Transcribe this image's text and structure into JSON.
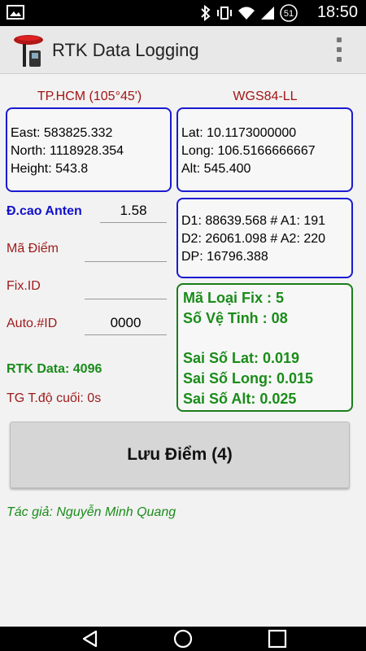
{
  "status_bar": {
    "time": "18:50",
    "battery_level": "51",
    "icons": [
      "image-icon",
      "bluetooth-icon",
      "vibrate-icon",
      "wifi-icon",
      "signal-icon",
      "battery-icon"
    ]
  },
  "action_bar": {
    "title": "RTK Data Logging",
    "overflow_icon": "more-vert-icon"
  },
  "headers": {
    "local": "TP.HCM (105°45')",
    "global": "WGS84-LL"
  },
  "local_coords": {
    "east": "East: 583825.332",
    "north": "North: 1118928.354",
    "height": "Height: 543.8"
  },
  "wgs_coords": {
    "lat": "Lat: 10.1173000000",
    "long": "Long: 106.5166666667",
    "alt": "Alt: 545.400"
  },
  "distances": {
    "d1": "D1: 88639.568 # A1: 191",
    "d2": "D2: 26061.098 # A2: 220",
    "dp": "DP: 16796.388"
  },
  "form": {
    "antenna_label": "Đ.cao Anten",
    "antenna_value": "1.58",
    "point_label": "Mã Điểm",
    "point_value": "",
    "fixid_label": "Fix.ID",
    "fixid_value": "",
    "autoid_label": "Auto.#ID",
    "autoid_value": "0000"
  },
  "status": {
    "fix_type": "Mã Loại Fix : 5",
    "satellites": "Số Vệ Tinh : 08",
    "err_lat": "Sai Số Lat: 0.019",
    "err_long": "Sai Số Long: 0.015",
    "err_alt": "Sai Số Alt: 0.025"
  },
  "rtk_data": "RTK Data: 4096",
  "last_time": "TG T.độ cuối: 0s",
  "save_button": "Lưu Điểm (4)",
  "author": "Tác giả: Nguyễn Minh Quang",
  "colors": {
    "blue_border": "#1a1ad0",
    "green_border": "#1a7d1a",
    "green_text": "#1a8c1a",
    "red_text": "#9e1a1a",
    "blue_text": "#1111cc"
  },
  "nav_bar": {
    "icons": [
      "back-icon",
      "home-icon",
      "recents-icon"
    ]
  }
}
